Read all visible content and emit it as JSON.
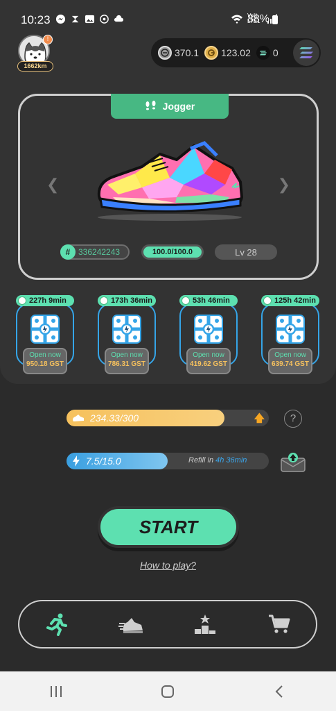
{
  "status_bar": {
    "time": "10:23",
    "battery": "88%",
    "network": "Vo)) LTE1"
  },
  "user": {
    "distance": "1662km",
    "notification_count": "!"
  },
  "balances": {
    "gmt": "370.1",
    "gst": "123.02",
    "sol": "0"
  },
  "sneaker": {
    "type": "Jogger",
    "id": "336242243",
    "durability": "100.0/100.0",
    "level": "Lv 28"
  },
  "mystery_boxes": [
    {
      "timer": "227h 9min",
      "action": "Open now",
      "price": "950.18 GST"
    },
    {
      "timer": "173h 36min",
      "action": "Open now",
      "price": "786.31 GST"
    },
    {
      "timer": "53h 46min",
      "action": "Open now",
      "price": "419.62 GST"
    },
    {
      "timer": "125h 42min",
      "action": "Open now",
      "price": "639.74 GST"
    }
  ],
  "energy": {
    "text": "234.33/300",
    "fraction": 0.78
  },
  "stamina": {
    "text": "7.5/15.0",
    "fraction": 0.5,
    "refill_label": "Refill in",
    "refill_time": "4h 36min"
  },
  "help_label": "?",
  "start_label": "START",
  "how_to_play": "How to play?",
  "bottom_nav": [
    "run-icon",
    "sneaker-icon",
    "leaderboard-icon",
    "cart-icon"
  ],
  "colors": {
    "accent": "#5de0b0",
    "energy": "#f6c15d",
    "stamina": "#3a9fe0",
    "panel": "#333333"
  }
}
